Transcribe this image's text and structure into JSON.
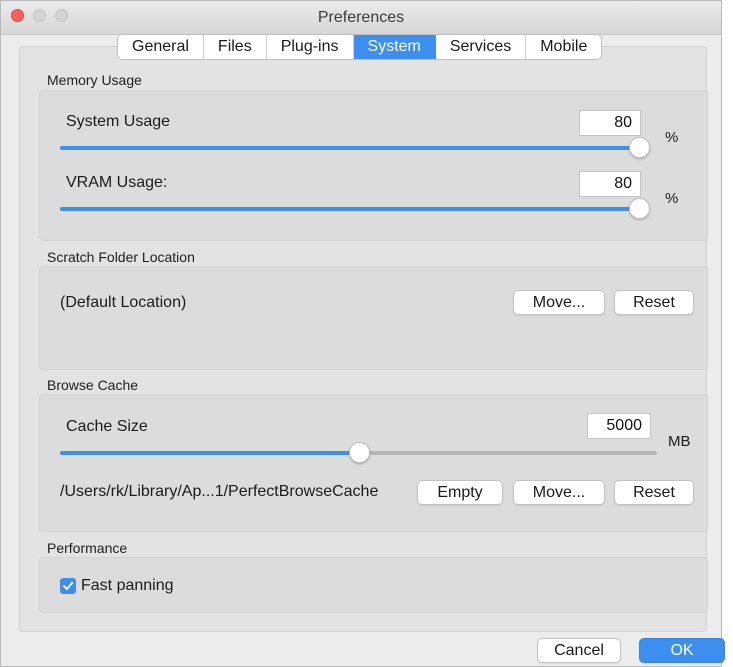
{
  "window": {
    "title": "Preferences"
  },
  "tabs": [
    {
      "label": "General",
      "active": false
    },
    {
      "label": "Files",
      "active": false
    },
    {
      "label": "Plug-ins",
      "active": false
    },
    {
      "label": "System",
      "active": true
    },
    {
      "label": "Services",
      "active": false
    },
    {
      "label": "Mobile",
      "active": false
    }
  ],
  "memory": {
    "section_title": "Memory Usage",
    "system": {
      "label": "System Usage",
      "value": "80",
      "unit": "%",
      "slider_fraction": 1.0
    },
    "vram": {
      "label": "VRAM Usage:",
      "value": "80",
      "unit": "%",
      "slider_fraction": 1.0
    }
  },
  "scratch": {
    "section_title": "Scratch Folder Location",
    "location": "(Default Location)",
    "move_label": "Move...",
    "reset_label": "Reset"
  },
  "cache": {
    "section_title": "Browse Cache",
    "size_label": "Cache Size",
    "size_value": "5000",
    "size_unit": "MB",
    "slider_fraction": 0.5,
    "path": "/Users/rk/Library/Ap...1/PerfectBrowseCache",
    "empty_label": "Empty",
    "move_label": "Move...",
    "reset_label": "Reset"
  },
  "performance": {
    "section_title": "Performance",
    "fast_panning_label": "Fast panning",
    "fast_panning_checked": true
  },
  "footer": {
    "cancel_label": "Cancel",
    "ok_label": "OK"
  },
  "colors": {
    "accent": "#3d8fef",
    "close": "#fc605c"
  }
}
